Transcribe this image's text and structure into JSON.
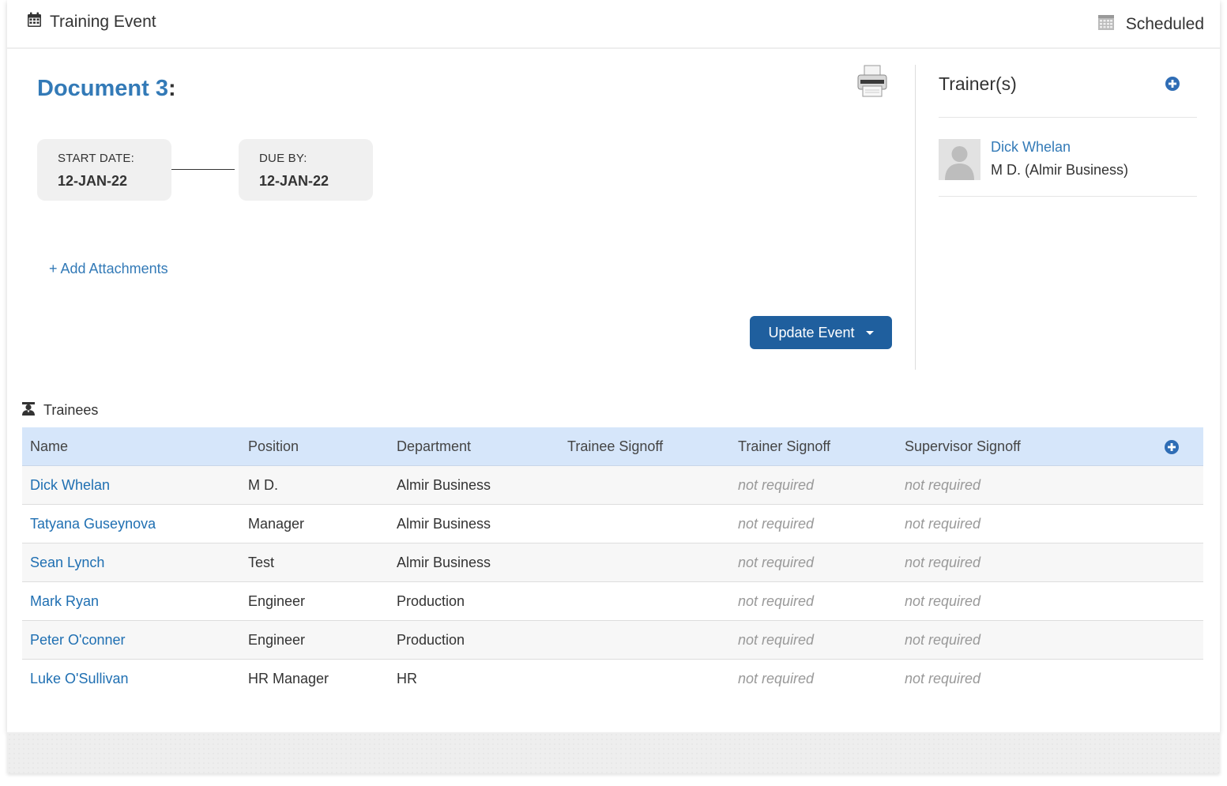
{
  "header": {
    "title": "Training Event",
    "title_icon": "calendar-icon",
    "status": "Scheduled",
    "status_icon": "calendar-grid-icon"
  },
  "document": {
    "title": "Document 3",
    "colon": ":",
    "print_icon": "printer-icon"
  },
  "dates": {
    "start_label": "START DATE:",
    "start_value": "12-JAN-22",
    "due_label": "DUE BY:",
    "due_value": "12-JAN-22"
  },
  "attachments": {
    "add_label": "+ Add Attachments"
  },
  "actions": {
    "update_label": "Update Event"
  },
  "trainers": {
    "title": "Trainer(s)",
    "items": [
      {
        "name": "Dick Whelan",
        "subtitle": "M D. (Almir Business)"
      }
    ]
  },
  "trainees": {
    "label": "Trainees",
    "columns": [
      "Name",
      "Position",
      "Department",
      "Trainee Signoff",
      "Trainer Signoff",
      "Supervisor Signoff"
    ],
    "rows": [
      {
        "name": "Dick Whelan",
        "position": "M D.",
        "department": "Almir Business",
        "trainee_signoff": "",
        "trainer_signoff": "not required",
        "supervisor_signoff": "not required"
      },
      {
        "name": "Tatyana Guseynova",
        "position": "Manager",
        "department": "Almir Business",
        "trainee_signoff": "",
        "trainer_signoff": "not required",
        "supervisor_signoff": "not required"
      },
      {
        "name": "Sean Lynch",
        "position": "Test",
        "department": "Almir Business",
        "trainee_signoff": "",
        "trainer_signoff": "not required",
        "supervisor_signoff": "not required"
      },
      {
        "name": "Mark Ryan",
        "position": "Engineer",
        "department": "Production",
        "trainee_signoff": "",
        "trainer_signoff": "not required",
        "supervisor_signoff": "not required"
      },
      {
        "name": "Peter O'conner",
        "position": "Engineer",
        "department": "Production",
        "trainee_signoff": "",
        "trainer_signoff": "not required",
        "supervisor_signoff": "not required"
      },
      {
        "name": "Luke O'Sullivan",
        "position": "HR Manager",
        "department": "HR",
        "trainee_signoff": "",
        "trainer_signoff": "not required",
        "supervisor_signoff": "not required"
      }
    ]
  },
  "colors": {
    "link": "#337ab7",
    "primary_button": "#1f5f9e",
    "table_header": "#d6e6fa",
    "muted_text": "#999999"
  }
}
